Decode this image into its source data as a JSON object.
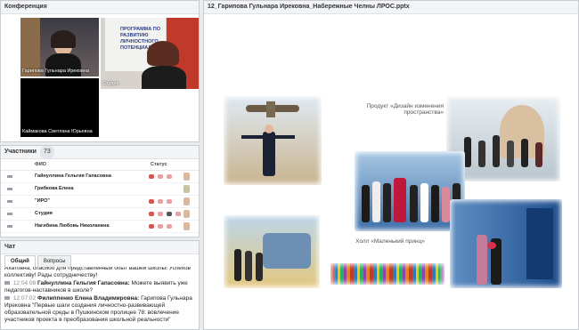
{
  "conference": {
    "title": "Конференция",
    "videos": [
      {
        "label": "Гарипова Гульнара Ирековна"
      },
      {
        "label": "Студия",
        "poster": "ПРОГРАММА ПО РАЗВИТИЮ ЛИЧНОСТНОГО ПОТЕНЦИАЛА"
      },
      {
        "label": "Каймакова Светлана Юрьевна"
      }
    ]
  },
  "participants": {
    "title": "Участники",
    "count": "73",
    "col_name": "ФИО",
    "col_status": "Статус",
    "rows": [
      {
        "name": "Гайнуллина Гельгия Гапасовна"
      },
      {
        "name": "Грибкова Елена"
      },
      {
        "name": "\"ИРО\""
      },
      {
        "name": "Студия"
      },
      {
        "name": "Нагибина Любовь  Николаевна"
      }
    ]
  },
  "chat": {
    "title": "Чат",
    "tabs": [
      "Общий",
      "Вопросы"
    ],
    "messages": [
      {
        "time": "",
        "author": "",
        "text": "Ахатовна, спасибо для представленный опыт вашей школы! Успехов коллективу! Рады сотрудничеству!"
      },
      {
        "time": "12:04:08",
        "author": "Гайнуллина Гельгия Гапасовна:",
        "text": "Можете выявить уже педагогов-наставников в школе?"
      },
      {
        "time": "12:07:02",
        "author": "Филиппенко Елена Владимировна:",
        "text": "Гарипова Гульнара Ирековна  \"Первые шаги создания личностно-развивающей образовательной среды в Пушкинском пролицее  78: вовлечение участников проекта в преобразования школьной реальности\""
      }
    ]
  },
  "presentation": {
    "file_title": "12_Гарипова Гульнара Ирековна_Набережные Челны ЛРОС.pptx",
    "caption_product": "Продукт «Дизайн изменения пространства»",
    "caption_hall": "Холл «Маленький принц»"
  },
  "colors": {
    "panel_header": "#f3f4f6",
    "accent": "#1e3f8a",
    "status_red": "#d9534f"
  }
}
